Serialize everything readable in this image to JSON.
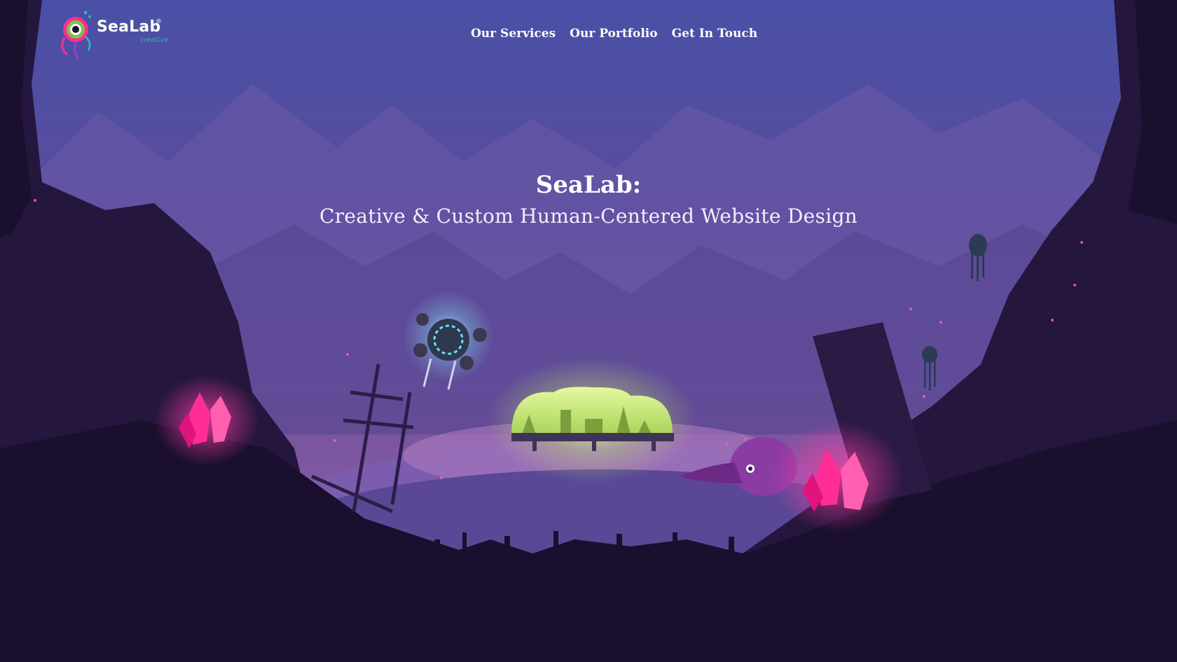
{
  "brand": {
    "name": "SeaLab",
    "registered_mark": "®",
    "tagline": "creative"
  },
  "nav": {
    "items": [
      {
        "label": "Our Services"
      },
      {
        "label": "Our Portfolio"
      },
      {
        "label": "Get In Touch"
      }
    ]
  },
  "hero": {
    "title": "SeaLab:",
    "subtitle": "Creative & Custom Human-Centered Website Design"
  },
  "colors": {
    "sky_top": "#4a51a8",
    "sky_mid": "#5d4a9a",
    "horizon": "#8a5aa6",
    "silhouette": "#1a0f2e",
    "crystal": "#ff2d95",
    "dome_glow": "#c6f06a",
    "accent_teal": "#2fb3b0"
  },
  "icons": [
    "sealab-logo-icon",
    "submarine-icon",
    "dome-city-icon",
    "squid-icon",
    "crystal-icon",
    "jellyfish-icon",
    "shipwreck-icon"
  ]
}
